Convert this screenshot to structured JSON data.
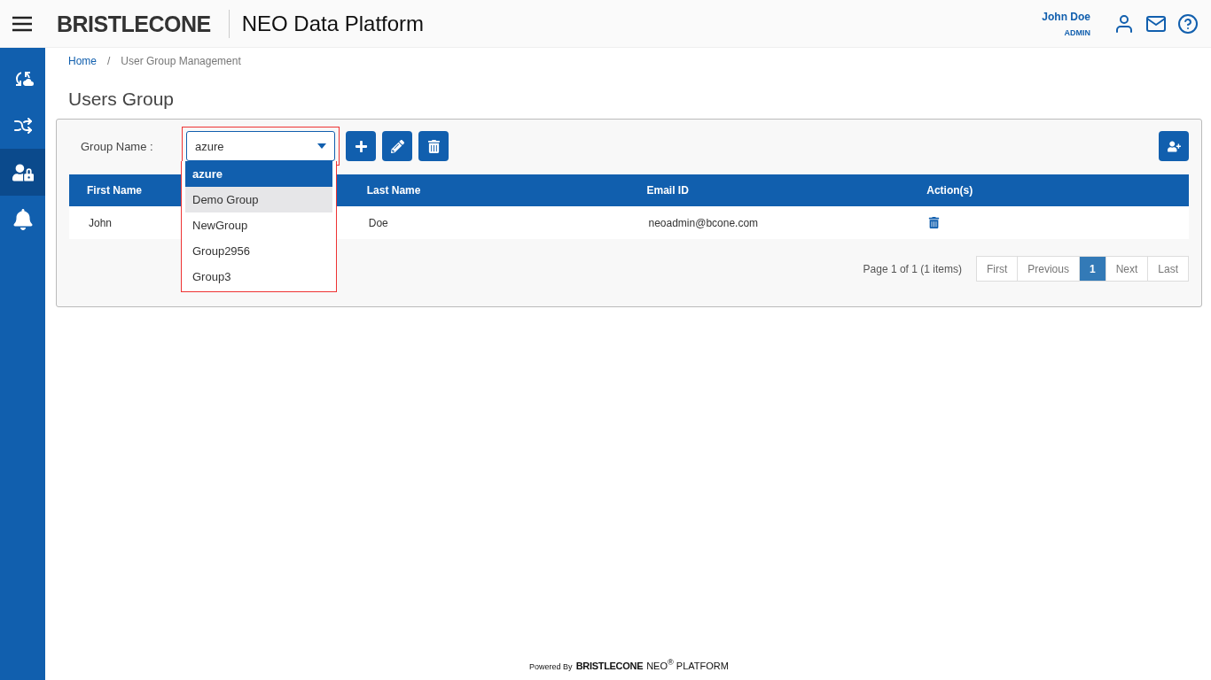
{
  "header": {
    "logo": "BRISTLECONE",
    "title": "NEO Data Platform",
    "user": {
      "name": "John Doe",
      "role": "ADMIN"
    }
  },
  "sidebar": {
    "items": [
      {
        "kind": "cloud",
        "selected": false
      },
      {
        "kind": "flows",
        "selected": false
      },
      {
        "kind": "users",
        "selected": true
      },
      {
        "kind": "bell",
        "selected": false
      }
    ]
  },
  "breadcrumb": [
    {
      "label": "Home",
      "kind": "link"
    },
    {
      "label": "/",
      "kind": "separator"
    },
    {
      "label": "User Group Management",
      "kind": "current"
    }
  ],
  "page_title": "Users Group",
  "group_select": {
    "label": "Group Name :",
    "value": "azure",
    "expanded": true,
    "options": [
      {
        "label": "azure",
        "selected": true,
        "hovered": false
      },
      {
        "label": "Demo Group",
        "selected": false,
        "hovered": true
      },
      {
        "label": "NewGroup",
        "selected": false,
        "hovered": false
      },
      {
        "label": "Group2956",
        "selected": false,
        "hovered": false
      },
      {
        "label": "Group3",
        "selected": false,
        "hovered": false
      }
    ]
  },
  "table": {
    "columns": [
      "First Name",
      "Last Name",
      "Email ID",
      "Action(s)"
    ],
    "rows": [
      {
        "cells": [
          "John",
          "Doe",
          "neoadmin@bcone.com"
        ]
      }
    ]
  },
  "pagination": {
    "summary": "Page 1 of 1 (1 items)",
    "buttons": [
      {
        "label": "First",
        "selected": false
      },
      {
        "label": "Previous",
        "selected": false
      },
      {
        "label": "1",
        "selected": true
      },
      {
        "label": "Next",
        "selected": false
      },
      {
        "label": "Last",
        "selected": false
      }
    ]
  },
  "footer": {
    "powered": "Powered By",
    "brand": "BRISTLECONE",
    "product": "NEO$^{®}$ PLATFORM"
  }
}
